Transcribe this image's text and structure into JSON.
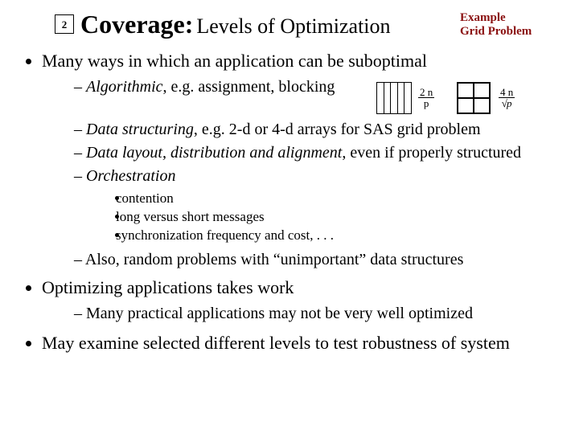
{
  "page_number": "2",
  "title_main": "Coverage:",
  "title_sub": " Levels of Optimization",
  "example_label_l1": "Example",
  "example_label_l2": "Grid Problem",
  "bullets": {
    "b1": "Many ways in which an application can be suboptimal",
    "b1a_em": "Algorithmic",
    "b1a_rest": ", e.g. assignment, blocking",
    "b1b_em": "Data structuring",
    "b1b_rest": ", e.g. 2-d or 4-d arrays for SAS grid problem",
    "b1c_em": "Data layout, distribution and alignment",
    "b1c_rest": ", even if properly structured",
    "b1d_em": "Orchestration",
    "b1d_s1": "contention",
    "b1d_s2": "long versus short messages",
    "b1d_s3": "synchronization frequency and cost, . . .",
    "b1e": "Also, random problems with “unimportant” data structures",
    "b2": "Optimizing applications takes work",
    "b2a": "Many practical applications may not be very well optimized",
    "b3": "May examine selected different levels to test robustness of system"
  },
  "diagrams": {
    "fracA_num": "2 n",
    "fracA_den": "p",
    "fracB_num": "4 n",
    "fracB_den": "p"
  }
}
